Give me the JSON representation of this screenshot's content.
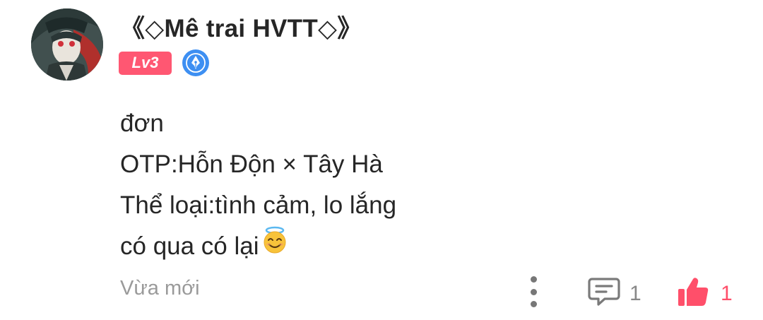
{
  "comment": {
    "avatar_icon": "user-avatar",
    "username": "《◇Mê trai HVTT◇》",
    "level_badge": "Lv3",
    "title_badge_icon": "fountain-pen-icon",
    "content_lines": [
      "đơn",
      "OTP:Hỗn Độn × Tây Hà",
      "Thể loại:tình cảm, lo lắng",
      "có qua có lại"
    ],
    "content_emoji": "smiling-face-with-halo",
    "timestamp": "Vừa mới",
    "actions": {
      "more_icon": "more-vertical-icon",
      "reply_icon": "comment-icon",
      "reply_count": "1",
      "like_icon": "thumbs-up-icon",
      "like_count": "1"
    }
  },
  "colors": {
    "level_badge_bg": "#ff5772",
    "title_badge_bg": "#3d8ff2",
    "like_color": "#ff4f6a",
    "muted_text": "#9a9a9a",
    "text": "#262626"
  }
}
